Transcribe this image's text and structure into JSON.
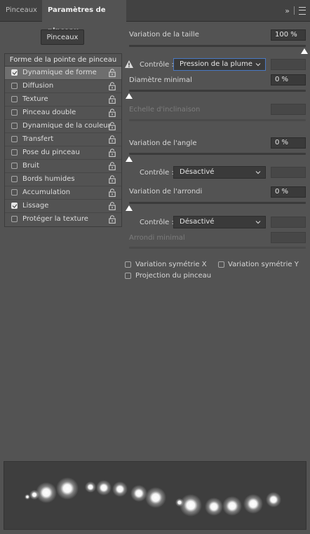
{
  "tabs": [
    {
      "label": "Pinceaux"
    },
    {
      "label": "Paramètres de pinceau"
    }
  ],
  "left": {
    "brushes_button": "Pinceaux",
    "tip_shape_label": "Forme de la pointe de pinceau",
    "options": [
      {
        "label": "Dynamique de forme",
        "checked": true,
        "selected": true
      },
      {
        "label": "Diffusion",
        "checked": false
      },
      {
        "label": "Texture",
        "checked": false
      },
      {
        "label": "Pinceau double",
        "checked": false
      },
      {
        "label": "Dynamique de la couleur",
        "checked": false
      },
      {
        "label": "Transfert",
        "checked": false
      },
      {
        "label": "Pose du pinceau",
        "checked": false
      },
      {
        "label": "Bruit",
        "checked": false
      },
      {
        "label": "Bords humides",
        "checked": false
      },
      {
        "label": "Accumulation",
        "checked": false
      },
      {
        "label": "Lissage",
        "checked": true
      },
      {
        "label": "Protéger la texture",
        "checked": false
      }
    ]
  },
  "right": {
    "size_jitter": {
      "label": "Variation de la taille",
      "value": "100 %",
      "level": 1.0
    },
    "control1": {
      "label": "Contrôle :",
      "value": "Pression de la plume"
    },
    "min_diameter": {
      "label": "Diamètre minimal",
      "value": "0 %",
      "level": 0.0
    },
    "tilt_scale": {
      "label": "Echelle d'inclinaison"
    },
    "angle_jitter": {
      "label": "Variation de l'angle",
      "value": "0 %",
      "level": 0.0
    },
    "control2": {
      "label": "Contrôle :",
      "value": "Désactivé"
    },
    "roundness_jitter": {
      "label": "Variation de l'arrondi",
      "value": "0 %",
      "level": 0.0
    },
    "control3": {
      "label": "Contrôle :",
      "value": "Désactivé"
    },
    "min_roundness": {
      "label": "Arrondi minimal"
    },
    "flip_x": {
      "label": "Variation symétrie X",
      "checked": false
    },
    "flip_y": {
      "label": "Variation symétrie Y",
      "checked": false
    },
    "brush_projection": {
      "label": "Projection du pinceau",
      "checked": false
    }
  },
  "colors": {
    "panel": "#535353",
    "tabbar": "#424242",
    "field": "#3a3a3a",
    "focus": "#4a78c2"
  }
}
